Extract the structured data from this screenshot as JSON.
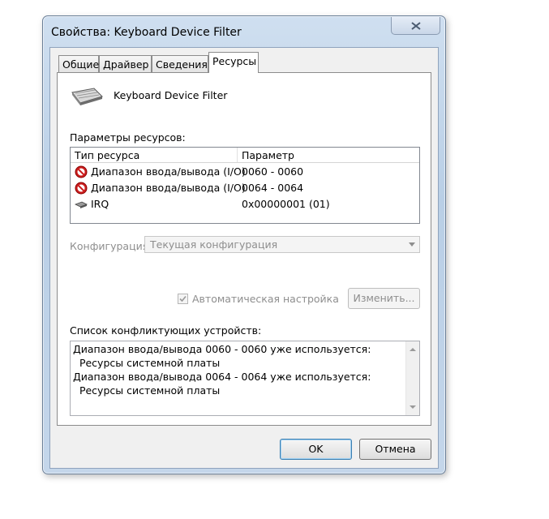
{
  "window": {
    "title": "Свойства: Keyboard Device Filter",
    "close_icon": "close-icon"
  },
  "tabs": [
    {
      "label": "Общие",
      "active": false
    },
    {
      "label": "Драйвер",
      "active": false
    },
    {
      "label": "Сведения",
      "active": false
    },
    {
      "label": "Ресурсы",
      "active": true
    }
  ],
  "device": {
    "name": "Keyboard Device Filter",
    "icon": "keyboard-icon"
  },
  "resources": {
    "section_label": "Параметры ресурсов:",
    "columns": [
      "Тип ресурса",
      "Параметр"
    ],
    "rows": [
      {
        "type": "Диапазон ввода/вывода (I/O)",
        "value": "0060 - 0060",
        "icon": "conflict-icon"
      },
      {
        "type": "Диапазон ввода/вывода (I/O)",
        "value": "0064 - 0064",
        "icon": "conflict-icon"
      },
      {
        "type": "IRQ",
        "value": "0x00000001 (01)",
        "icon": "irq-chip-icon"
      }
    ]
  },
  "configuration": {
    "label": "Конфигурация:",
    "selected": "Текущая конфигурация"
  },
  "auto_setting": {
    "label": "Автоматическая настройка",
    "checked": true
  },
  "change_button": "Изменить...",
  "conflicts": {
    "label": "Список конфликтующих устройств:",
    "lines": [
      "Диапазон ввода/вывода 0060 - 0060 уже используется:",
      "  Ресурсы системной платы",
      "Диапазон ввода/вывода 0064 - 0064 уже используется:",
      "  Ресурсы системной платы"
    ]
  },
  "buttons": {
    "ok": "OK",
    "cancel": "Отмена"
  },
  "colors": {
    "frame": "#b9cfe6",
    "disabled_text": "#8e8e8e",
    "conflict_red": "#cc1f1f"
  }
}
